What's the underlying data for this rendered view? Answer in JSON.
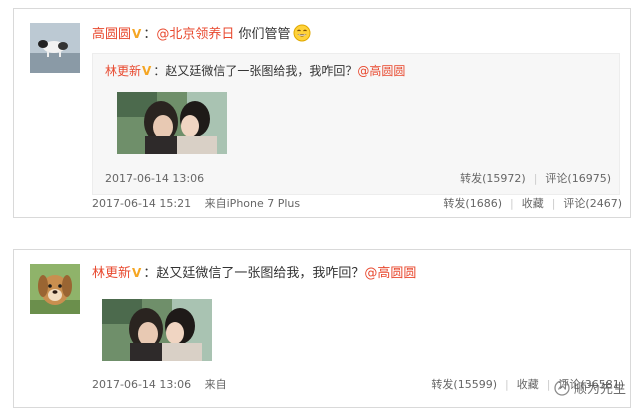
{
  "post1": {
    "author": "高圆圆",
    "mention": "@北京领养日",
    "text": "你们管管",
    "emoji": "grinning-face-emoji",
    "repost": {
      "author": "林更新",
      "text": "赵又廷微信了一张图给我，我咋回？",
      "mention": "@高圆圆",
      "time": "2017-06-14 13:06",
      "repost_label": "转发(15972)",
      "comment_label": "评论(16975)"
    },
    "time": "2017-06-14 15:21",
    "source": "来自iPhone 7 Plus",
    "repost_label": "转发(1686)",
    "favorite_label": "收藏",
    "comment_label": "评论(2467)"
  },
  "post2": {
    "author": "林更新",
    "text": "赵又廷微信了一张图给我，我咋回？",
    "mention": "@高圆圆",
    "time": "2017-06-14 13:06",
    "source": "来自",
    "repost_label": "转发(15599)",
    "favorite_label": "收藏",
    "comment_label": "评论(36581)"
  },
  "watermark": "顺为先生",
  "colors": {
    "name": "#e8492f",
    "v_badge": "#f5a623",
    "border": "#d9d9d9",
    "repost_bg": "#f7f7f7"
  }
}
